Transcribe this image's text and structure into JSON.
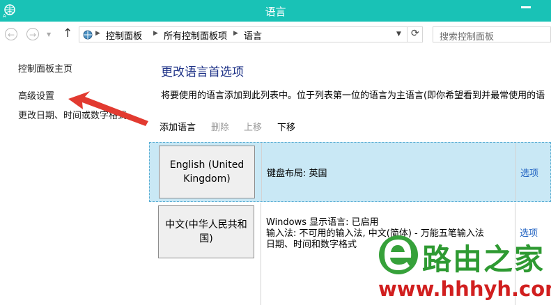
{
  "window": {
    "title": "语言",
    "app_icon": "language-globe-icon",
    "accent": "#19c2b6"
  },
  "addressbar": {
    "crumbs": [
      "控制面板",
      "所有控制面板项",
      "语言"
    ],
    "search_placeholder": "搜索控制面板",
    "icons": [
      "back-arrow-icon",
      "forward-arrow-icon",
      "chevron-down-icon",
      "up-arrow-icon",
      "control-panel-icon",
      "refresh-icon"
    ]
  },
  "sidebar": {
    "items": [
      {
        "label": "控制面板主页"
      },
      {
        "label": "高级设置"
      },
      {
        "label": "更改日期、时间或数字格式"
      }
    ]
  },
  "main": {
    "heading": "更改语言首选项",
    "description": "将要使用的语言添加到此列表中。位于列表第一位的语言为主语言(即你希望看到并最常使用的语",
    "toolbar": {
      "add": "添加语言",
      "remove": "删除",
      "move_up": "上移",
      "move_down": "下移"
    },
    "languages": [
      {
        "name": "English (United Kingdom)",
        "details": [
          "键盘布局: 英国"
        ],
        "options": "选项",
        "selected": true
      },
      {
        "name": "中文(中华人民共和国)",
        "details": [
          "Windows 显示语言: 已启用",
          "输入法: 不可用的输入法, 中文(简体) - 万能五笔输入法",
          "日期、时间和数字格式"
        ],
        "options": "选项",
        "selected": false
      }
    ]
  },
  "watermark": {
    "name": "路由之家",
    "url": "www.hhhyh.com",
    "badge": "e-logo-icon"
  },
  "annotation": {
    "arrow_color": "#e23a30",
    "arrow_icon": "red-pointer-arrow-icon"
  }
}
